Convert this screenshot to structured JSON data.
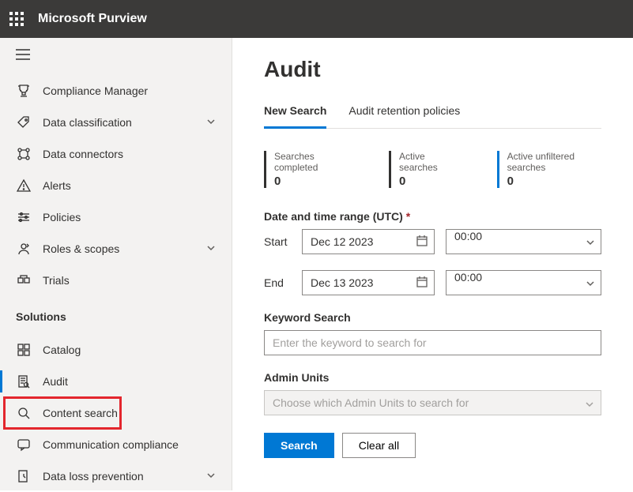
{
  "header": {
    "product": "Microsoft Purview"
  },
  "sidebar": {
    "top_items": [
      {
        "label": "Compliance Manager",
        "icon": "trophy",
        "expandable": false
      },
      {
        "label": "Data classification",
        "icon": "tag",
        "expandable": true
      },
      {
        "label": "Data connectors",
        "icon": "connector",
        "expandable": false
      },
      {
        "label": "Alerts",
        "icon": "alert",
        "expandable": false
      },
      {
        "label": "Policies",
        "icon": "policies",
        "expandable": false
      },
      {
        "label": "Roles & scopes",
        "icon": "roles",
        "expandable": true
      },
      {
        "label": "Trials",
        "icon": "trials",
        "expandable": false
      }
    ],
    "section_header": "Solutions",
    "solution_items": [
      {
        "label": "Catalog",
        "icon": "catalog",
        "expandable": false
      },
      {
        "label": "Audit",
        "icon": "audit",
        "expandable": false,
        "active": true
      },
      {
        "label": "Content search",
        "icon": "search",
        "expandable": false
      },
      {
        "label": "Communication compliance",
        "icon": "comm",
        "expandable": false
      },
      {
        "label": "Data loss prevention",
        "icon": "dlp",
        "expandable": true
      }
    ]
  },
  "main": {
    "title": "Audit",
    "tabs": [
      {
        "label": "New Search",
        "active": true
      },
      {
        "label": "Audit retention policies",
        "active": false
      }
    ],
    "stats": [
      {
        "label": "Searches completed",
        "value": "0",
        "accent": false
      },
      {
        "label": "Active searches",
        "value": "0",
        "accent": false
      },
      {
        "label": "Active unfiltered searches",
        "value": "0",
        "accent": true
      }
    ],
    "date_range_label": "Date and time range (UTC)",
    "start_label": "Start",
    "end_label": "End",
    "start_date": "Dec 12 2023",
    "start_time": "00:00",
    "end_date": "Dec 13 2023",
    "end_time": "00:00",
    "keyword_label": "Keyword Search",
    "keyword_placeholder": "Enter the keyword to search for",
    "admin_units_label": "Admin Units",
    "admin_units_placeholder": "Choose which Admin Units to search for",
    "search_btn": "Search",
    "clear_btn": "Clear all"
  }
}
